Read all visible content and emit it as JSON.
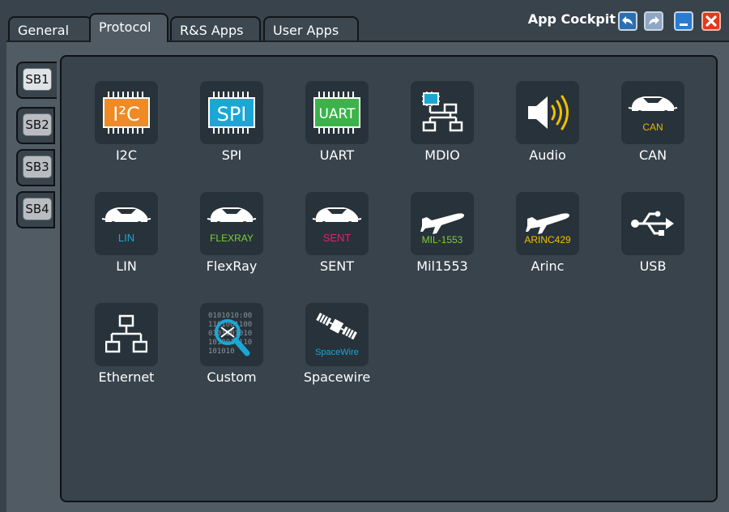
{
  "tabs": {
    "general": "General",
    "protocol": "Protocol",
    "rs_apps": "R&S Apps",
    "user_apps": "User Apps"
  },
  "title": "App Cockpit",
  "side_tabs": [
    "SB1",
    "SB2",
    "SB3",
    "SB4"
  ],
  "apps": {
    "i2c": {
      "label": "I2C",
      "icon_text": "I²C"
    },
    "spi": {
      "label": "SPI",
      "icon_text": "SPI"
    },
    "uart": {
      "label": "UART",
      "icon_text": "UART"
    },
    "mdio": {
      "label": "MDIO"
    },
    "audio": {
      "label": "Audio"
    },
    "can": {
      "label": "CAN",
      "icon_text": "CAN"
    },
    "lin": {
      "label": "LIN",
      "icon_text": "LIN"
    },
    "flexray": {
      "label": "FlexRay",
      "icon_text": "FLEXRAY"
    },
    "sent": {
      "label": "SENT",
      "icon_text": "SENT"
    },
    "mil1553": {
      "label": "Mil1553",
      "icon_text": "MIL-1553"
    },
    "arinc": {
      "label": "Arinc",
      "icon_text": "ARINC429"
    },
    "usb": {
      "label": "USB"
    },
    "ethernet": {
      "label": "Ethernet"
    },
    "custom": {
      "label": "Custom"
    },
    "spacewire": {
      "label": "Spacewire",
      "icon_text": "SpaceWire"
    }
  },
  "colors": {
    "background": "#38434c",
    "tile": "#27323a",
    "i2c_orange": "#f08a24",
    "spi_cyan": "#1aa7d6",
    "uart_green": "#3bb34a",
    "can_yellow": "#e6b800",
    "lin_cyan": "#1aa7d6",
    "flexray_green": "#7fcf3a",
    "sent_pink": "#e0226e",
    "mil_green": "#7fcf3a",
    "arinc_yellow": "#f0c000",
    "close_red": "#e03a1c"
  }
}
